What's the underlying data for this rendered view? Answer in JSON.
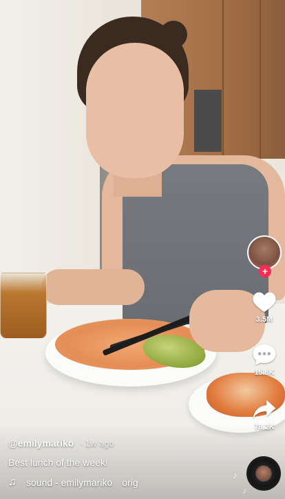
{
  "video": {
    "description_scene": ""
  },
  "rail": {
    "likes": "3.5M",
    "comments": "15.6K",
    "shares": "78.2K",
    "follow_symbol": "+"
  },
  "caption": {
    "username": "@emilymariko",
    "posted": "· 1w ago",
    "description": "Best lunch of the week!",
    "sound": "sound - emilymariko",
    "sound_suffix": "orig"
  },
  "icons": {
    "like": "heart-icon",
    "comment": "comment-icon",
    "share": "share-arrow-icon",
    "music": "music-note-icon",
    "disc": "music-disc-icon"
  },
  "colors": {
    "accent": "#fe2c55",
    "text": "#ffffff"
  }
}
